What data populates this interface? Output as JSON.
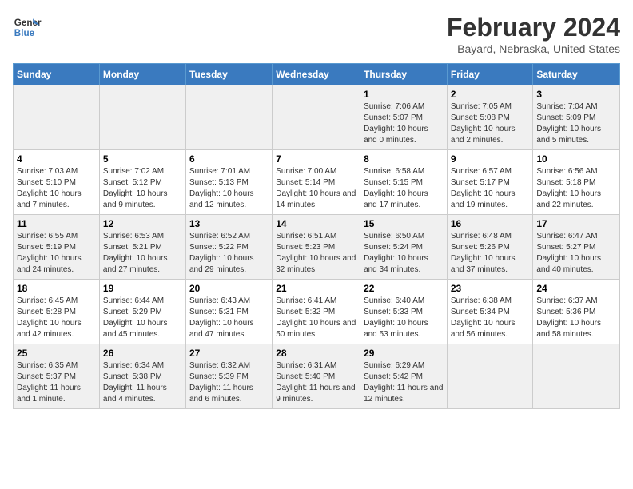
{
  "header": {
    "logo_line1": "General",
    "logo_line2": "Blue",
    "month_year": "February 2024",
    "location": "Bayard, Nebraska, United States"
  },
  "weekdays": [
    "Sunday",
    "Monday",
    "Tuesday",
    "Wednesday",
    "Thursday",
    "Friday",
    "Saturday"
  ],
  "weeks": [
    [
      {
        "day": "",
        "info": ""
      },
      {
        "day": "",
        "info": ""
      },
      {
        "day": "",
        "info": ""
      },
      {
        "day": "",
        "info": ""
      },
      {
        "day": "1",
        "info": "Sunrise: 7:06 AM\nSunset: 5:07 PM\nDaylight: 10 hours\nand 0 minutes."
      },
      {
        "day": "2",
        "info": "Sunrise: 7:05 AM\nSunset: 5:08 PM\nDaylight: 10 hours\nand 2 minutes."
      },
      {
        "day": "3",
        "info": "Sunrise: 7:04 AM\nSunset: 5:09 PM\nDaylight: 10 hours\nand 5 minutes."
      }
    ],
    [
      {
        "day": "4",
        "info": "Sunrise: 7:03 AM\nSunset: 5:10 PM\nDaylight: 10 hours\nand 7 minutes."
      },
      {
        "day": "5",
        "info": "Sunrise: 7:02 AM\nSunset: 5:12 PM\nDaylight: 10 hours\nand 9 minutes."
      },
      {
        "day": "6",
        "info": "Sunrise: 7:01 AM\nSunset: 5:13 PM\nDaylight: 10 hours\nand 12 minutes."
      },
      {
        "day": "7",
        "info": "Sunrise: 7:00 AM\nSunset: 5:14 PM\nDaylight: 10 hours\nand 14 minutes."
      },
      {
        "day": "8",
        "info": "Sunrise: 6:58 AM\nSunset: 5:15 PM\nDaylight: 10 hours\nand 17 minutes."
      },
      {
        "day": "9",
        "info": "Sunrise: 6:57 AM\nSunset: 5:17 PM\nDaylight: 10 hours\nand 19 minutes."
      },
      {
        "day": "10",
        "info": "Sunrise: 6:56 AM\nSunset: 5:18 PM\nDaylight: 10 hours\nand 22 minutes."
      }
    ],
    [
      {
        "day": "11",
        "info": "Sunrise: 6:55 AM\nSunset: 5:19 PM\nDaylight: 10 hours\nand 24 minutes."
      },
      {
        "day": "12",
        "info": "Sunrise: 6:53 AM\nSunset: 5:21 PM\nDaylight: 10 hours\nand 27 minutes."
      },
      {
        "day": "13",
        "info": "Sunrise: 6:52 AM\nSunset: 5:22 PM\nDaylight: 10 hours\nand 29 minutes."
      },
      {
        "day": "14",
        "info": "Sunrise: 6:51 AM\nSunset: 5:23 PM\nDaylight: 10 hours\nand 32 minutes."
      },
      {
        "day": "15",
        "info": "Sunrise: 6:50 AM\nSunset: 5:24 PM\nDaylight: 10 hours\nand 34 minutes."
      },
      {
        "day": "16",
        "info": "Sunrise: 6:48 AM\nSunset: 5:26 PM\nDaylight: 10 hours\nand 37 minutes."
      },
      {
        "day": "17",
        "info": "Sunrise: 6:47 AM\nSunset: 5:27 PM\nDaylight: 10 hours\nand 40 minutes."
      }
    ],
    [
      {
        "day": "18",
        "info": "Sunrise: 6:45 AM\nSunset: 5:28 PM\nDaylight: 10 hours\nand 42 minutes."
      },
      {
        "day": "19",
        "info": "Sunrise: 6:44 AM\nSunset: 5:29 PM\nDaylight: 10 hours\nand 45 minutes."
      },
      {
        "day": "20",
        "info": "Sunrise: 6:43 AM\nSunset: 5:31 PM\nDaylight: 10 hours\nand 47 minutes."
      },
      {
        "day": "21",
        "info": "Sunrise: 6:41 AM\nSunset: 5:32 PM\nDaylight: 10 hours\nand 50 minutes."
      },
      {
        "day": "22",
        "info": "Sunrise: 6:40 AM\nSunset: 5:33 PM\nDaylight: 10 hours\nand 53 minutes."
      },
      {
        "day": "23",
        "info": "Sunrise: 6:38 AM\nSunset: 5:34 PM\nDaylight: 10 hours\nand 56 minutes."
      },
      {
        "day": "24",
        "info": "Sunrise: 6:37 AM\nSunset: 5:36 PM\nDaylight: 10 hours\nand 58 minutes."
      }
    ],
    [
      {
        "day": "25",
        "info": "Sunrise: 6:35 AM\nSunset: 5:37 PM\nDaylight: 11 hours\nand 1 minute."
      },
      {
        "day": "26",
        "info": "Sunrise: 6:34 AM\nSunset: 5:38 PM\nDaylight: 11 hours\nand 4 minutes."
      },
      {
        "day": "27",
        "info": "Sunrise: 6:32 AM\nSunset: 5:39 PM\nDaylight: 11 hours\nand 6 minutes."
      },
      {
        "day": "28",
        "info": "Sunrise: 6:31 AM\nSunset: 5:40 PM\nDaylight: 11 hours\nand 9 minutes."
      },
      {
        "day": "29",
        "info": "Sunrise: 6:29 AM\nSunset: 5:42 PM\nDaylight: 11 hours\nand 12 minutes."
      },
      {
        "day": "",
        "info": ""
      },
      {
        "day": "",
        "info": ""
      }
    ]
  ]
}
